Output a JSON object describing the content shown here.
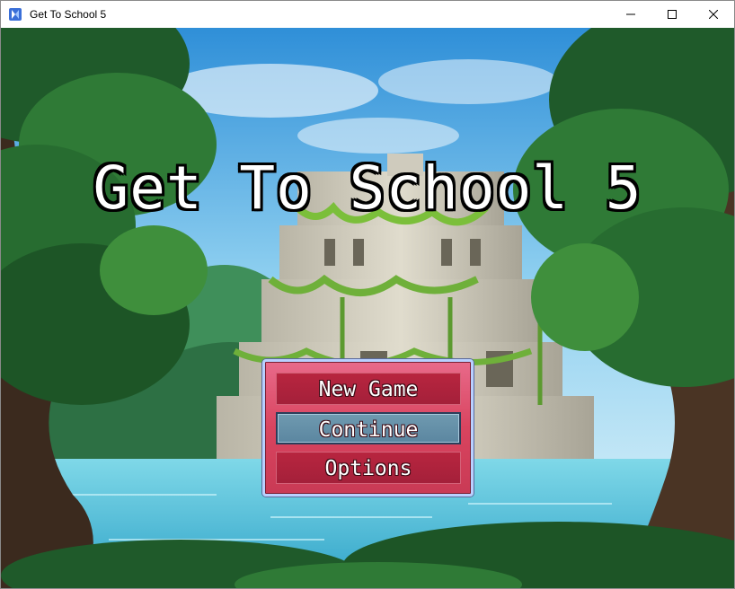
{
  "window": {
    "title": "Get To School 5",
    "icon": "rpg-maker-app-icon",
    "controls": [
      "minimize-icon",
      "maximize-icon",
      "close-icon"
    ]
  },
  "game": {
    "title": "Get To School 5",
    "menu": [
      {
        "label": "New Game",
        "selected": false
      },
      {
        "label": "Continue",
        "selected": true
      },
      {
        "label": "Options",
        "selected": false
      }
    ]
  },
  "colors": {
    "menu_window": "#d9445f",
    "menu_border": "#b9d0ff",
    "selected_item": "#5b86a0",
    "title_text": "#ffffff"
  }
}
